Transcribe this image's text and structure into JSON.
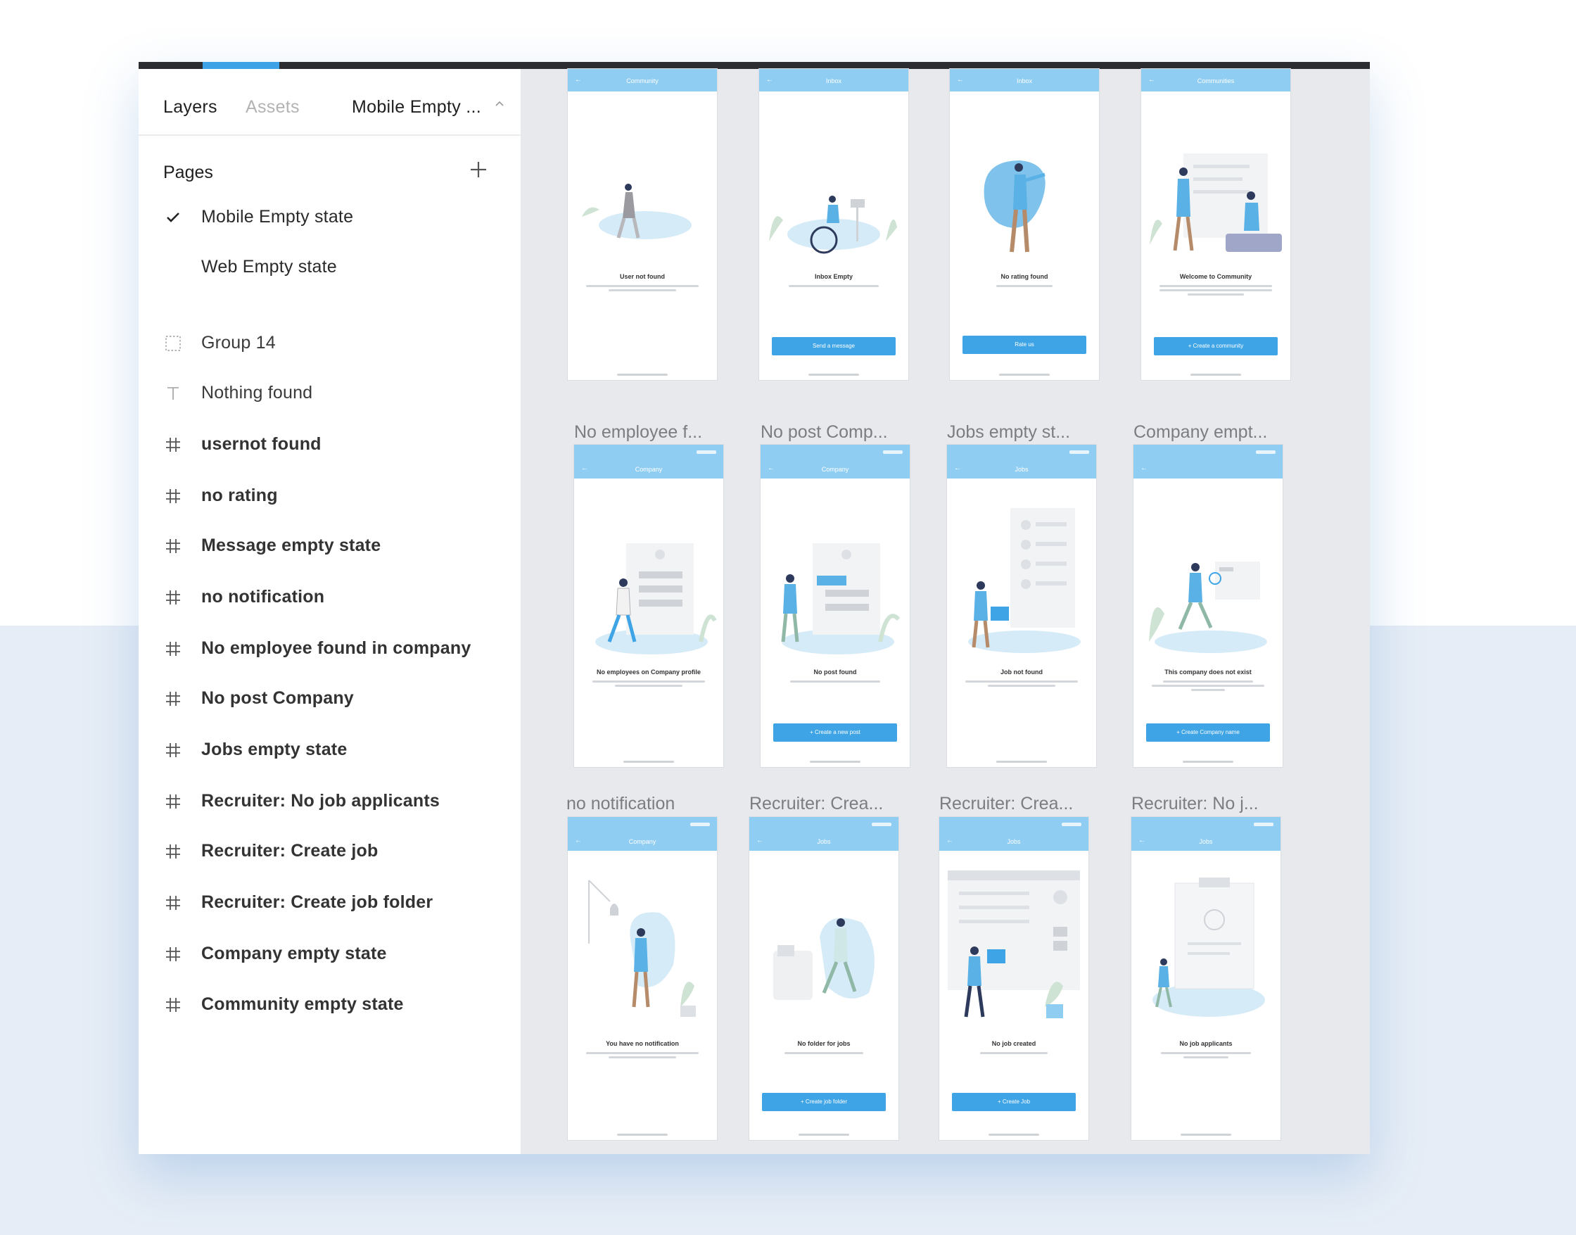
{
  "sidebar": {
    "tabs": {
      "layers": "Layers",
      "assets": "Assets",
      "page_select": "Mobile Empty ..."
    },
    "pages_label": "Pages",
    "pages": [
      "Mobile Empty state",
      "Web Empty state"
    ],
    "layers": [
      {
        "icon": "group-icon",
        "label": "Group 14"
      },
      {
        "icon": "text-icon",
        "label": "Nothing found"
      },
      {
        "icon": "frame-icon",
        "label": "usernot found"
      },
      {
        "icon": "frame-icon",
        "label": "no rating"
      },
      {
        "icon": "frame-icon",
        "label": "Message empty state"
      },
      {
        "icon": "frame-icon",
        "label": "no notification"
      },
      {
        "icon": "frame-icon",
        "label": "No employee found in company"
      },
      {
        "icon": "frame-icon",
        "label": "No post Company"
      },
      {
        "icon": "frame-icon",
        "label": "Jobs empty state"
      },
      {
        "icon": "frame-icon",
        "label": "Recruiter: No job applicants"
      },
      {
        "icon": "frame-icon",
        "label": "Recruiter: Create job"
      },
      {
        "icon": "frame-icon",
        "label": "Recruiter: Create job folder"
      },
      {
        "icon": "frame-icon",
        "label": "Company empty state"
      },
      {
        "icon": "frame-icon",
        "label": "Community empty state"
      }
    ]
  },
  "canvas": {
    "row1": [
      {
        "header": "Community",
        "message": "User not found",
        "button": ""
      },
      {
        "header": "Inbox",
        "message": "Inbox Empty",
        "button": "Send a message"
      },
      {
        "header": "Inbox",
        "message": "No rating found",
        "button": "Rate us"
      },
      {
        "header": "Communities",
        "message": "Welcome to Community",
        "button": "+ Create a community"
      }
    ],
    "row2": [
      {
        "label": "No employee f...",
        "header": "Company",
        "message": "No employees on Company profile",
        "button": ""
      },
      {
        "label": "No post Comp...",
        "header": "Company",
        "message": "No post found",
        "button": "+ Create a new post"
      },
      {
        "label": "Jobs empty st...",
        "header": "Jobs",
        "message": "Job not found",
        "button": ""
      },
      {
        "label": "Company empt...",
        "header": "",
        "message": "This company does not exist",
        "button": "+ Create Company name"
      }
    ],
    "row3": [
      {
        "label": "no notification",
        "header": "Company",
        "message": "You have no notification",
        "button": ""
      },
      {
        "label": "Recruiter: Crea...",
        "header": "Jobs",
        "message": "No folder for jobs",
        "button": "+ Create job folder"
      },
      {
        "label": "Recruiter: Crea...",
        "header": "Jobs",
        "message": "No job created",
        "button": "+ Create Job"
      },
      {
        "label": "Recruiter: No j...",
        "header": "Jobs",
        "message": "No job applicants",
        "button": ""
      }
    ]
  },
  "colors": {
    "accent": "#3da2e6",
    "frame_header": "#8fcdf2",
    "canvas_bg": "#e8e9ec",
    "page_bg_bottom": "#e6edf6"
  }
}
